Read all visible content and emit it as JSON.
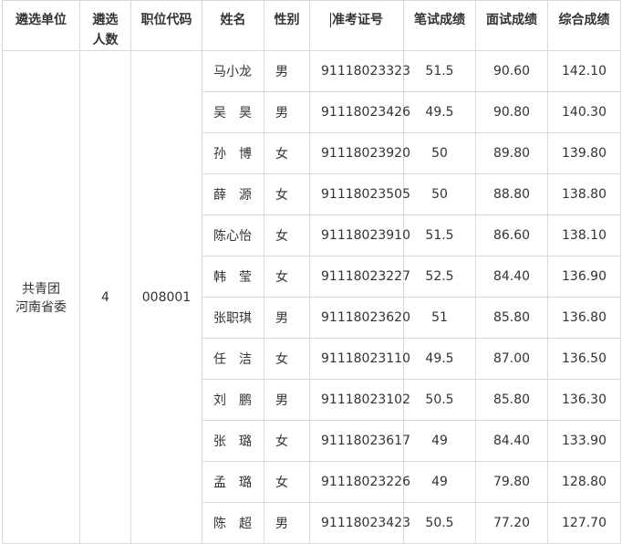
{
  "headers": {
    "unit": "遴选单位",
    "count_line1": "遴选",
    "count_line2": "人数",
    "code": "职位代码",
    "name": "姓名",
    "gender": "性别",
    "exam_no": "准考证号",
    "written": "笔试成绩",
    "interview": "面试成绩",
    "total": "综合成绩"
  },
  "group": {
    "unit_line1": "共青团",
    "unit_line2": "河南省委",
    "count": "4",
    "code": "008001"
  },
  "rows": [
    {
      "name": "马小龙",
      "gender": "男",
      "exam_no": "91118023323",
      "written": "51.5",
      "interview": "90.60",
      "total": "142.10"
    },
    {
      "name": "吴　昊",
      "gender": "男",
      "exam_no": "91118023426",
      "written": "49.5",
      "interview": "90.80",
      "total": "140.30"
    },
    {
      "name": "孙　博",
      "gender": "女",
      "exam_no": "91118023920",
      "written": "50",
      "interview": "89.80",
      "total": "139.80"
    },
    {
      "name": "薛　源",
      "gender": "女",
      "exam_no": "91118023505",
      "written": "50",
      "interview": "88.80",
      "total": "138.80"
    },
    {
      "name": "陈心怡",
      "gender": "女",
      "exam_no": "91118023910",
      "written": "51.5",
      "interview": "86.60",
      "total": "138.10"
    },
    {
      "name": "韩　莹",
      "gender": "女",
      "exam_no": "91118023227",
      "written": "52.5",
      "interview": "84.40",
      "total": "136.90"
    },
    {
      "name": "张职琪",
      "gender": "男",
      "exam_no": "91118023620",
      "written": "51",
      "interview": "85.80",
      "total": "136.80"
    },
    {
      "name": "任　洁",
      "gender": "女",
      "exam_no": "91118023110",
      "written": "49.5",
      "interview": "87.00",
      "total": "136.50"
    },
    {
      "name": "刘　鹏",
      "gender": "男",
      "exam_no": "91118023102",
      "written": "50.5",
      "interview": "85.80",
      "total": "136.30"
    },
    {
      "name": "张　璐",
      "gender": "女",
      "exam_no": "91118023617",
      "written": "49",
      "interview": "84.40",
      "total": "133.90"
    },
    {
      "name": "孟　璐",
      "gender": "女",
      "exam_no": "91118023226",
      "written": "49",
      "interview": "79.80",
      "total": "128.80"
    },
    {
      "name": "陈　超",
      "gender": "男",
      "exam_no": "91118023423",
      "written": "50.5",
      "interview": "77.20",
      "total": "127.70"
    }
  ]
}
